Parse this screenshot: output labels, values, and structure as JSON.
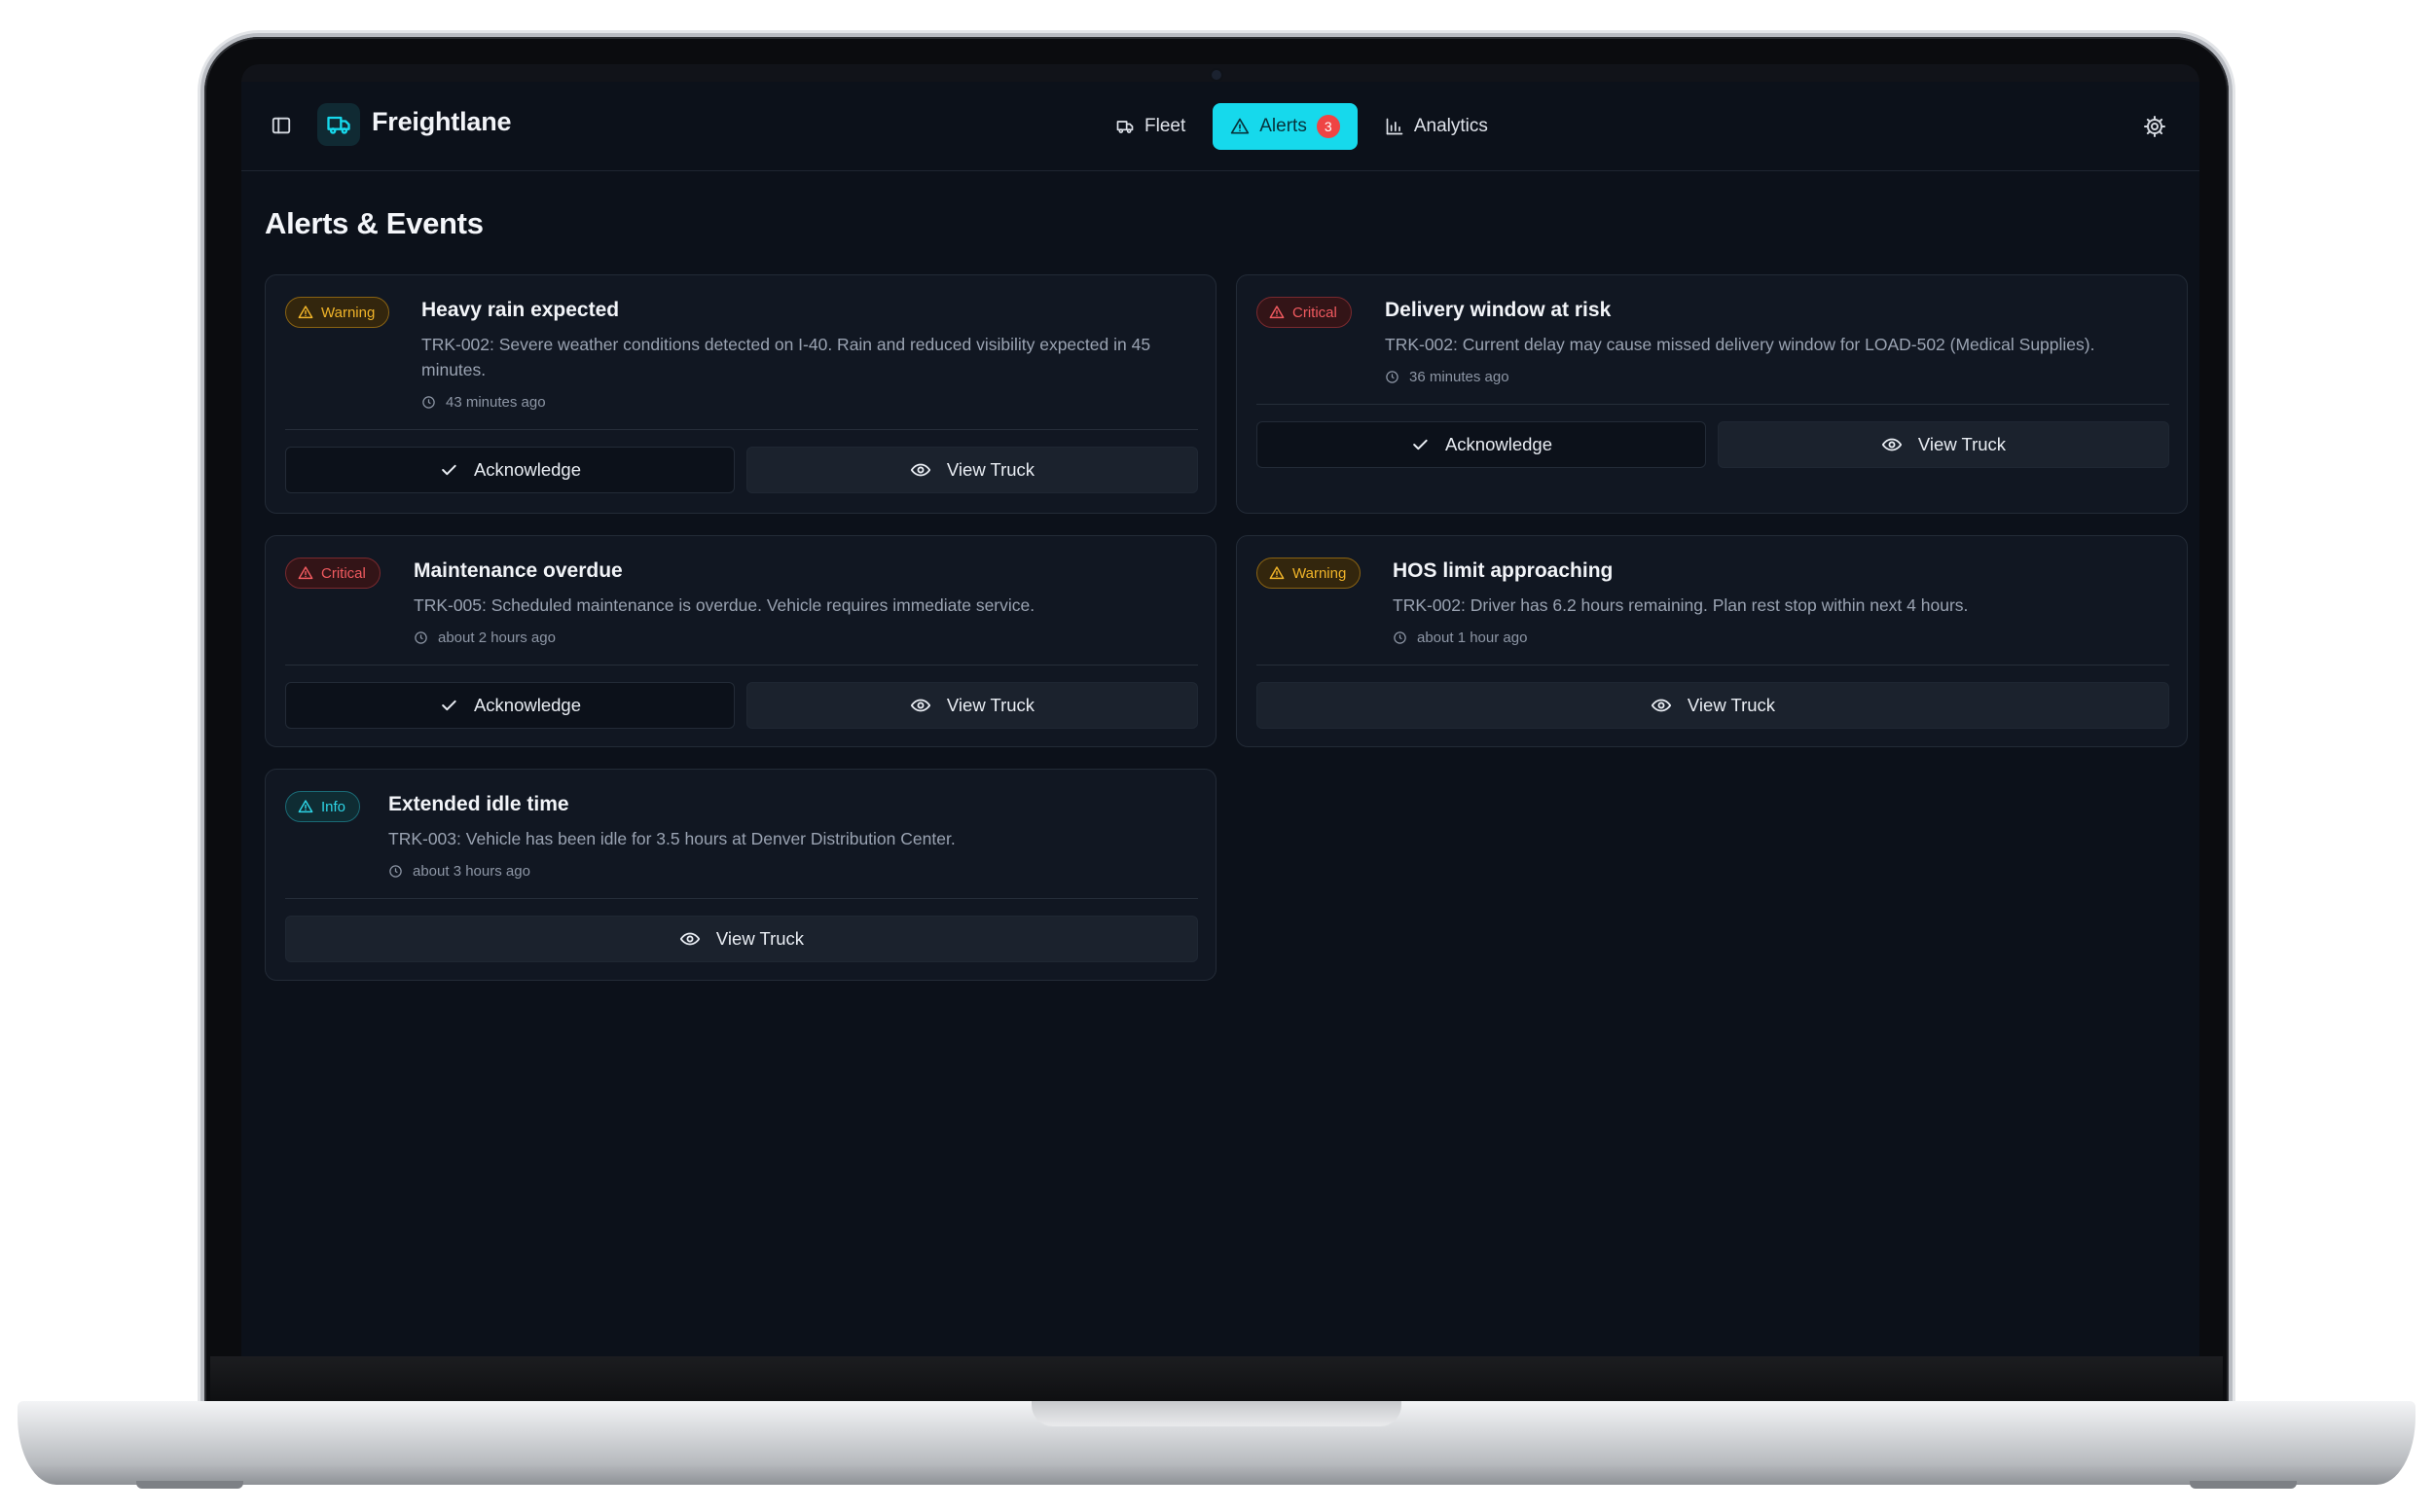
{
  "app": {
    "name": "Freightlane"
  },
  "nav": {
    "items": [
      {
        "label": "Fleet",
        "icon": "truck-icon"
      },
      {
        "label": "Alerts",
        "icon": "alert-triangle-icon",
        "badge": "3"
      },
      {
        "label": "Analytics",
        "icon": "bar-chart-icon"
      }
    ],
    "active": "Alerts"
  },
  "page": {
    "title": "Alerts & Events"
  },
  "actions": {
    "acknowledge": "Acknowledge",
    "view_truck": "View Truck"
  },
  "alerts": [
    {
      "severity": "Warning",
      "title": "Heavy rain expected",
      "description": "TRK-002: Severe weather conditions detected on I-40. Rain and reduced visibility expected in 45 minutes.",
      "time": "43 minutes ago"
    },
    {
      "severity": "Critical",
      "title": "Delivery window at risk",
      "description": "TRK-002: Current delay may cause missed delivery window for LOAD-502 (Medical Supplies).",
      "time": "36 minutes ago"
    },
    {
      "severity": "Critical",
      "title": "Maintenance overdue",
      "description": "TRK-005: Scheduled maintenance is overdue. Vehicle requires immediate service.",
      "time": "about 2 hours ago"
    },
    {
      "severity": "Warning",
      "title": "HOS limit approaching",
      "description": "TRK-002: Driver has 6.2 hours remaining. Plan rest stop within next 4 hours.",
      "time": "about 1 hour ago"
    },
    {
      "severity": "Info",
      "title": "Extended idle time",
      "description": "TRK-003: Vehicle has been idle for 3.5 hours at Denver Distribution Center.",
      "time": "about 3 hours ago"
    }
  ],
  "colors": {
    "accent": "#16d9ec",
    "background": "#0c111a",
    "card": "#111722",
    "warning": "#f0b429",
    "critical": "#f05a5f",
    "info": "#2dd4e6",
    "badge_red": "#ef4444"
  }
}
